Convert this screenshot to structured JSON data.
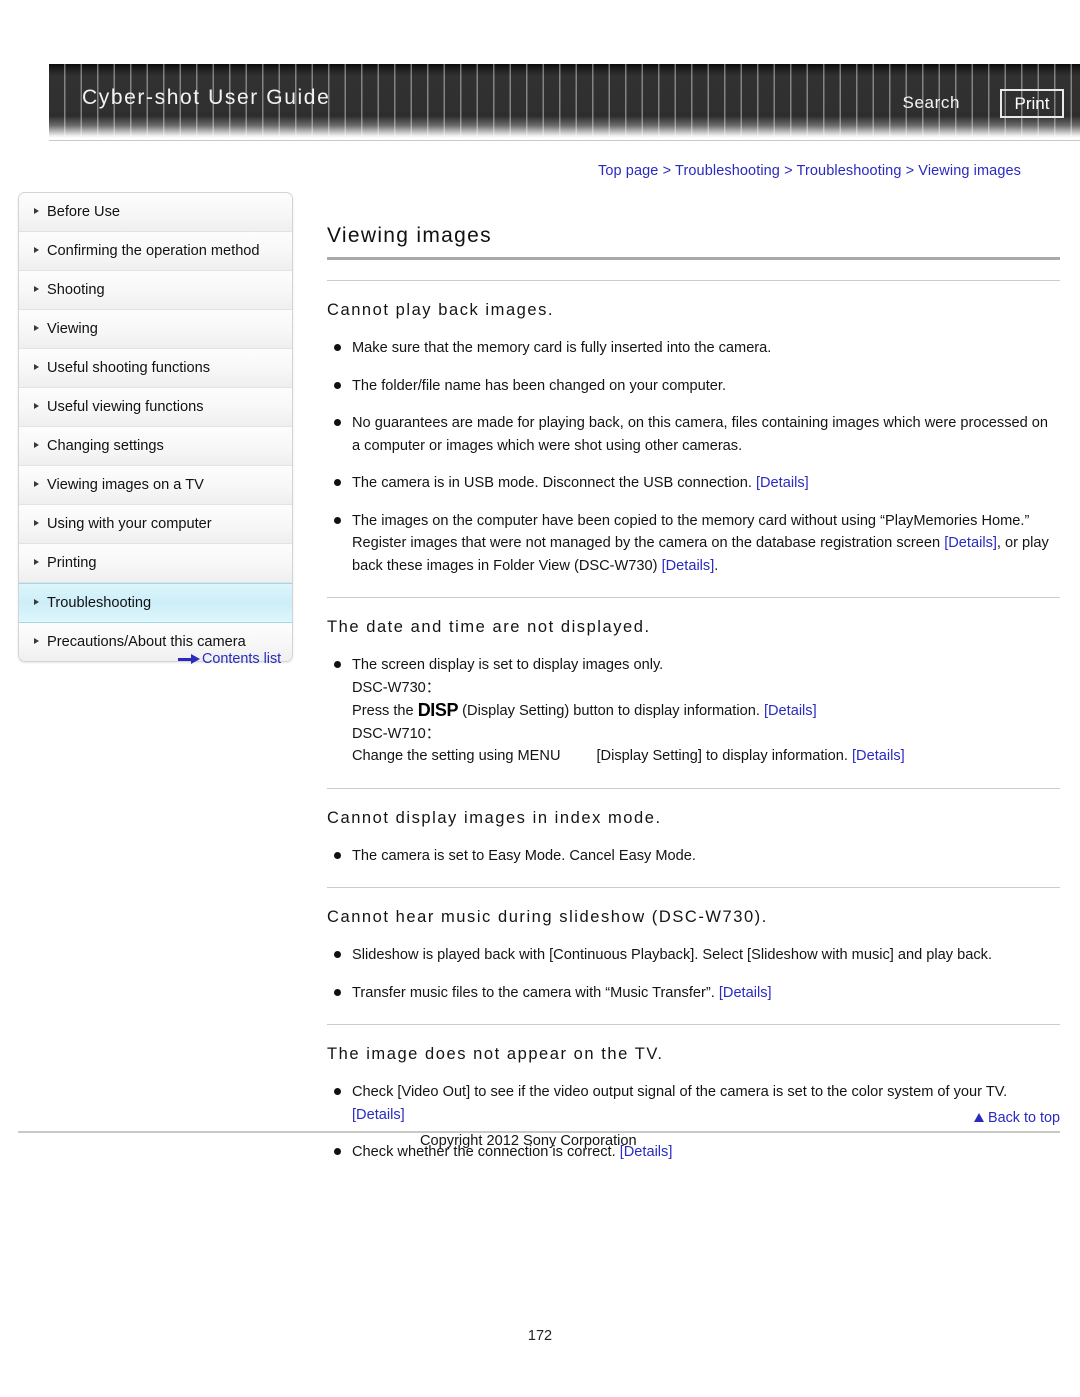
{
  "header": {
    "title": "Cyber-shot User Guide",
    "search_label": "Search",
    "print_label": "Print"
  },
  "breadcrumb": {
    "items": [
      "Top page",
      "Troubleshooting",
      "Troubleshooting",
      "Viewing images"
    ],
    "separator": ">",
    "full_text": "Top page > Troubleshooting > Troubleshooting > Viewing images"
  },
  "sidebar": {
    "items": [
      {
        "label": "Before Use",
        "active": false
      },
      {
        "label": "Confirming the operation method",
        "active": false
      },
      {
        "label": "Shooting",
        "active": false
      },
      {
        "label": "Viewing",
        "active": false
      },
      {
        "label": "Useful shooting functions",
        "active": false
      },
      {
        "label": "Useful viewing functions",
        "active": false
      },
      {
        "label": "Changing settings",
        "active": false
      },
      {
        "label": "Viewing images on a TV",
        "active": false
      },
      {
        "label": "Using with your computer",
        "active": false
      },
      {
        "label": "Printing",
        "active": false
      },
      {
        "label": "Troubleshooting",
        "active": true
      },
      {
        "label": "Precautions/About this camera",
        "active": false
      }
    ],
    "contents_list_label": "Contents list"
  },
  "main": {
    "page_title": "Viewing images",
    "sections": [
      {
        "heading": "Cannot play back images.",
        "bullets": [
          {
            "parts": [
              {
                "t": "Make sure that the memory card is fully inserted into the camera.",
                "link": false
              }
            ]
          },
          {
            "parts": [
              {
                "t": "The folder/file name has been changed on your computer.",
                "link": false
              }
            ]
          },
          {
            "parts": [
              {
                "t": "No guarantees are made for playing back, on this camera, files containing images which were processed on a computer or images which were shot using other cameras.",
                "link": false
              }
            ]
          },
          {
            "parts": [
              {
                "t": "The camera is in USB mode. Disconnect the USB connection. ",
                "link": false
              },
              {
                "t": "[Details]",
                "link": true
              }
            ]
          },
          {
            "parts": [
              {
                "t": "The images on the computer have been copied to the memory card without using “PlayMemories Home.” Register images that were not managed by the camera on the database registration screen ",
                "link": false
              },
              {
                "t": "[Details]",
                "link": true
              },
              {
                "t": ", or play back these images in Folder View (DSC-W730) ",
                "link": false
              },
              {
                "t": "[Details]",
                "link": true
              },
              {
                "t": ".",
                "link": false
              }
            ]
          }
        ]
      },
      {
        "heading": "The date and time are not displayed.",
        "bullets": [
          {
            "parts": [
              {
                "t": "The screen display is set to display images only.",
                "link": false
              },
              {
                "t": "BR",
                "link": false
              },
              {
                "t": "DSC-W730：",
                "link": false
              },
              {
                "t": "BR",
                "link": false
              },
              {
                "t": "Press the ",
                "link": false
              },
              {
                "t": "DISP",
                "icon": true
              },
              {
                "t": " (Display Setting) button to display information. ",
                "link": false
              },
              {
                "t": "[Details]",
                "link": true
              },
              {
                "t": "BR",
                "link": false
              },
              {
                "t": "DSC-W710：",
                "link": false
              },
              {
                "t": "BR",
                "link": false
              },
              {
                "t": "Change the setting using MENU",
                "link": false
              },
              {
                "t": "GAP",
                "link": false
              },
              {
                "t": "[Display Setting] to display information. ",
                "link": false
              },
              {
                "t": "[Details]",
                "link": true
              }
            ]
          }
        ]
      },
      {
        "heading": "Cannot display images in index mode.",
        "bullets": [
          {
            "parts": [
              {
                "t": "The camera is set to Easy Mode. Cancel Easy Mode.",
                "link": false
              }
            ]
          }
        ]
      },
      {
        "heading": "Cannot hear music during slideshow (DSC-W730).",
        "bullets": [
          {
            "parts": [
              {
                "t": "Slideshow is played back with [Continuous Playback]. Select [Slideshow with music] and play back.",
                "link": false
              }
            ]
          },
          {
            "parts": [
              {
                "t": "Transfer music files to the camera with “Music Transfer”. ",
                "link": false
              },
              {
                "t": "[Details]",
                "link": true
              }
            ]
          }
        ]
      },
      {
        "heading": "The image does not appear on the TV.",
        "bullets": [
          {
            "parts": [
              {
                "t": "Check [Video Out] to see if the video output signal of the camera is set to the color system of your TV. ",
                "link": false
              },
              {
                "t": "[Details]",
                "link": true
              }
            ]
          },
          {
            "parts": [
              {
                "t": "Check whether the connection is correct. ",
                "link": false
              },
              {
                "t": "[Details]",
                "link": true
              }
            ]
          }
        ]
      }
    ]
  },
  "footer": {
    "back_to_top_label": "Back to top",
    "copyright": "Copyright 2012 Sony Corporation",
    "page_number": "172"
  },
  "colors": {
    "link": "#2a2ac0",
    "active_nav": "#cdeef8",
    "header_dark": "#303030"
  }
}
